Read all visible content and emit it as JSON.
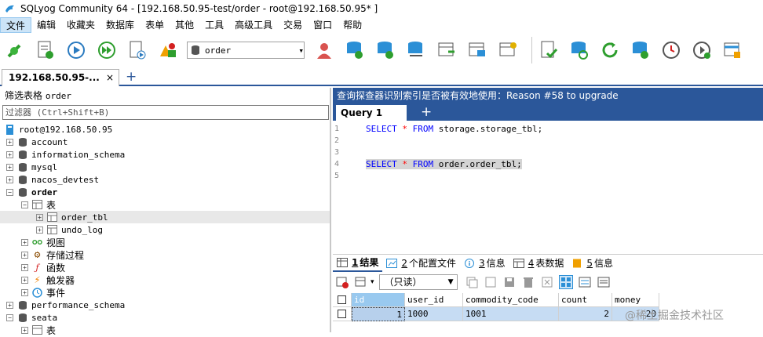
{
  "window": {
    "title": "SQLyog Community 64 - [192.168.50.95-test/order - root@192.168.50.95* ]"
  },
  "menu": [
    "文件",
    "编辑",
    "收藏夹",
    "数据库",
    "表单",
    "其他",
    "工具",
    "高级工具",
    "交易",
    "窗口",
    "帮助"
  ],
  "toolbar": {
    "database_select": "order"
  },
  "connection_tab": {
    "label": "192.168.50.95-...",
    "close": "×",
    "add": "+"
  },
  "object_browser": {
    "filter_label": "筛选表格",
    "filter_target": "order",
    "filter_placeholder": "过滤器 (Ctrl+Shift+B)",
    "root": "root@192.168.50.95",
    "databases": [
      "account",
      "information_schema",
      "mysql",
      "nacos_devtest",
      "order",
      "performance_schema",
      "seata"
    ],
    "order_children": {
      "tables_folder": "表",
      "tables": [
        "order_tbl",
        "undo_log"
      ],
      "views": "视图",
      "procs": "存储过程",
      "funcs": "函数",
      "triggers": "触发器",
      "events": "事件"
    },
    "seata_child": "表"
  },
  "info_bar": "查询探查器识别索引是否被有效地使用：Reason #58 to upgrade",
  "query_tab": {
    "label": "Query 1",
    "add": "+"
  },
  "editor": {
    "line_numbers": [
      "1",
      "2",
      "3",
      "4",
      "5"
    ],
    "line1": {
      "kw1": "SELECT",
      "op": "*",
      "kw2": "FROM",
      "rest": "storage.storage_tbl;"
    },
    "line4": {
      "kw1": "SELECT",
      "op": "*",
      "kw2": "FROM",
      "rest": "order.order_tbl;"
    }
  },
  "result_tabs": [
    {
      "num": "1",
      "label": "结果"
    },
    {
      "num": "2",
      "label": "个配置文件"
    },
    {
      "num": "3",
      "label": "信息"
    },
    {
      "num": "4",
      "label": "表数据"
    },
    {
      "num": "5",
      "label": "信息"
    }
  ],
  "result_toolbar": {
    "mode": "（只读）"
  },
  "grid": {
    "columns": [
      "id",
      "user_id",
      "commodity_code",
      "count",
      "money"
    ],
    "rows": [
      [
        "1",
        "1000",
        "1001",
        "2",
        "20"
      ]
    ]
  },
  "watermark": "@稀土掘金技术社区"
}
